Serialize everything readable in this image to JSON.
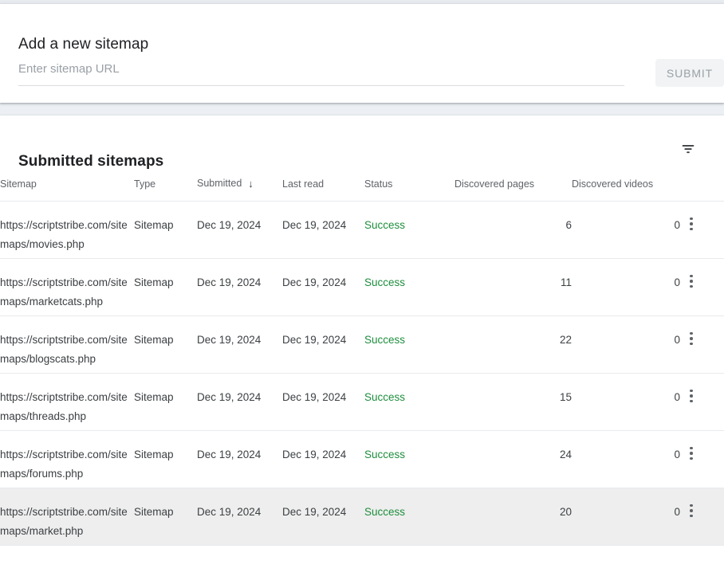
{
  "add_sitemap": {
    "title": "Add a new sitemap",
    "input": {
      "placeholder": "Enter sitemap URL",
      "value": ""
    },
    "submit_label": "SUBMIT"
  },
  "submitted": {
    "title": "Submitted sitemaps",
    "filter_icon": "filter-icon",
    "sort": {
      "column": "Submitted",
      "direction": "descending",
      "arrow_glyph": "↓"
    },
    "columns": [
      {
        "key": "sitemap",
        "label": "Sitemap"
      },
      {
        "key": "type",
        "label": "Type"
      },
      {
        "key": "submitted",
        "label": "Submitted"
      },
      {
        "key": "last_read",
        "label": "Last read"
      },
      {
        "key": "status",
        "label": "Status"
      },
      {
        "key": "discovered_pages",
        "label": "Discovered pages"
      },
      {
        "key": "discovered_videos",
        "label": "Discovered videos"
      }
    ],
    "rows": [
      {
        "sitemap": "https://scriptstribe.com/sitemaps/movies.php",
        "type": "Sitemap",
        "submitted": "Dec 19, 2024",
        "last_read": "Dec 19, 2024",
        "status": "Success",
        "discovered_pages": "6",
        "discovered_videos": "0",
        "hovered": false
      },
      {
        "sitemap": "https://scriptstribe.com/sitemaps/marketcats.php",
        "type": "Sitemap",
        "submitted": "Dec 19, 2024",
        "last_read": "Dec 19, 2024",
        "status": "Success",
        "discovered_pages": "11",
        "discovered_videos": "0",
        "hovered": false
      },
      {
        "sitemap": "https://scriptstribe.com/sitemaps/blogscats.php",
        "type": "Sitemap",
        "submitted": "Dec 19, 2024",
        "last_read": "Dec 19, 2024",
        "status": "Success",
        "discovered_pages": "22",
        "discovered_videos": "0",
        "hovered": false
      },
      {
        "sitemap": "https://scriptstribe.com/sitemaps/threads.php",
        "type": "Sitemap",
        "submitted": "Dec 19, 2024",
        "last_read": "Dec 19, 2024",
        "status": "Success",
        "discovered_pages": "15",
        "discovered_videos": "0",
        "hovered": false
      },
      {
        "sitemap": "https://scriptstribe.com/sitemaps/forums.php",
        "type": "Sitemap",
        "submitted": "Dec 19, 2024",
        "last_read": "Dec 19, 2024",
        "status": "Success",
        "discovered_pages": "24",
        "discovered_videos": "0",
        "hovered": false
      },
      {
        "sitemap": "https://scriptstribe.com/sitemaps/market.php",
        "type": "Sitemap",
        "submitted": "Dec 19, 2024",
        "last_read": "Dec 19, 2024",
        "status": "Success",
        "discovered_pages": "20",
        "discovered_videos": "0",
        "hovered": true
      }
    ],
    "row_menu_icon": "more-vert-icon"
  },
  "colors": {
    "success": "#1e8e3e",
    "text_primary": "#202124",
    "text_secondary": "#5f6368",
    "row_hover": "#eeeeee",
    "page_background": "#eceff3"
  }
}
